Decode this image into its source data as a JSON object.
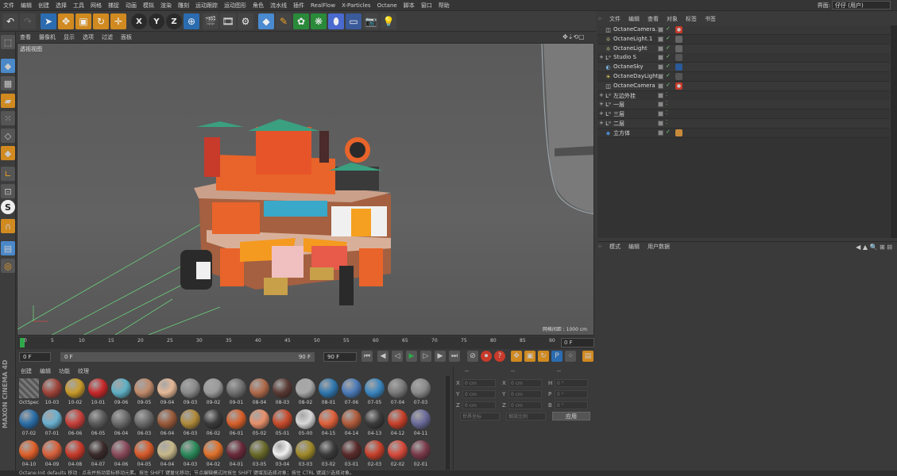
{
  "menubar": {
    "items": [
      "文件",
      "编辑",
      "创建",
      "选择",
      "工具",
      "网格",
      "捕捉",
      "动画",
      "模拟",
      "渲染",
      "雕刻",
      "运动跟踪",
      "运动图形",
      "角色",
      "流水线",
      "插件",
      "RealFlow",
      "X-Particles",
      "Octane",
      "脚本",
      "窗口",
      "帮助"
    ],
    "layout_label": "界面:",
    "layout_value": "仔仔 (用户)"
  },
  "viewport": {
    "menu": [
      "查看",
      "摄像机",
      "显示",
      "选项",
      "过滤",
      "面板"
    ],
    "label": "透视视图",
    "grid_label": "网格间距 : 1000 cm"
  },
  "timeline": {
    "ticks": [
      "0",
      "5",
      "10",
      "15",
      "20",
      "25",
      "30",
      "35",
      "40",
      "45",
      "50",
      "55",
      "60",
      "65",
      "70",
      "75",
      "80",
      "85",
      "90"
    ],
    "current_frame": "0 F",
    "start_field": "0 F",
    "range_start": "0 F",
    "range_end": "90 F",
    "end_field": "90 F"
  },
  "materials": {
    "menu": [
      "创建",
      "编辑",
      "功能",
      "纹理"
    ],
    "items": [
      {
        "label": "OctSpec",
        "color": "#6b6b6b"
      },
      {
        "label": "10-03",
        "color": "#a0443a"
      },
      {
        "label": "10-02",
        "color": "#c89a2a"
      },
      {
        "label": "10-01",
        "color": "#c8282a"
      },
      {
        "label": "09-06",
        "color": "#5fb0c6"
      },
      {
        "label": "09-05",
        "color": "#c08a6a"
      },
      {
        "label": "09-04",
        "color": "#e6b896"
      },
      {
        "label": "09-03",
        "color": "#8a8a8a"
      },
      {
        "label": "09-02",
        "color": "#9a9a9a"
      },
      {
        "label": "09-01",
        "color": "#707070"
      },
      {
        "label": "08-04",
        "color": "#b06a4a"
      },
      {
        "label": "08-03",
        "color": "#5a3a34"
      },
      {
        "label": "08-02",
        "color": "#a8a8a8"
      },
      {
        "label": "08-01",
        "color": "#2f78b0"
      },
      {
        "label": "07-06",
        "color": "#4a7ab8"
      },
      {
        "label": "07-05",
        "color": "#3a86c0"
      },
      {
        "label": "07-04",
        "color": "#7a7a7a"
      },
      {
        "label": "07-03",
        "color": "#8a8a8a"
      },
      {
        "label": "07-02",
        "color": "#2a6ea8"
      },
      {
        "label": "07-01",
        "color": "#6ab0d0"
      },
      {
        "label": "06-06",
        "color": "#c8403a"
      },
      {
        "label": "06-05",
        "color": "#5a5a5a"
      },
      {
        "label": "06-04",
        "color": "#6a6a6a"
      },
      {
        "label": "06-03",
        "color": "#6a6a6a"
      },
      {
        "label": "06-04",
        "color": "#9a5a3a"
      },
      {
        "label": "06-03",
        "color": "#b08a3a"
      },
      {
        "label": "06-02",
        "color": "#3a3a3a"
      },
      {
        "label": "06-01",
        "color": "#d8602a"
      },
      {
        "label": "05-02",
        "color": "#e8906a"
      },
      {
        "label": "05-01",
        "color": "#c84a2a"
      },
      {
        "label": "05-00",
        "color": "#d8d8d8"
      },
      {
        "label": "04-15",
        "color": "#e0603a"
      },
      {
        "label": "04-14",
        "color": "#b05a3a"
      },
      {
        "label": "04-13",
        "color": "#3a3a3a"
      },
      {
        "label": "04-12",
        "color": "#c8402a"
      },
      {
        "label": "04-11",
        "color": "#6a6a9a"
      },
      {
        "label": "04-10",
        "color": "#e0602a"
      },
      {
        "label": "04-09",
        "color": "#d8603a"
      },
      {
        "label": "04-08",
        "color": "#c83a2a"
      },
      {
        "label": "04-07",
        "color": "#3a2a2a"
      },
      {
        "label": "04-06",
        "color": "#8a4a5a"
      },
      {
        "label": "04-05",
        "color": "#d85a2a"
      },
      {
        "label": "04-04",
        "color": "#c8b88a"
      },
      {
        "label": "04-03",
        "color": "#2a8a5a"
      },
      {
        "label": "04-02",
        "color": "#e0702a"
      },
      {
        "label": "04-01",
        "color": "#6a2a3a"
      },
      {
        "label": "03-05",
        "color": "#6a6a2a"
      },
      {
        "label": "03-04",
        "color": "#f0f0f0"
      },
      {
        "label": "03-03",
        "color": "#a08a2a"
      },
      {
        "label": "03-02",
        "color": "#3a3a3a"
      },
      {
        "label": "03-01",
        "color": "#5a2a2a"
      },
      {
        "label": "02-03",
        "color": "#c8402a"
      },
      {
        "label": "02-02",
        "color": "#d84a3a"
      },
      {
        "label": "02-01",
        "color": "#7a3a4a"
      }
    ]
  },
  "coordinates": {
    "header": "--",
    "rows": [
      {
        "a": "X",
        "av": "0 cm",
        "b": "X",
        "bv": "0 cm",
        "c": "H",
        "cv": "0 °"
      },
      {
        "a": "Y",
        "av": "0 cm",
        "b": "Y",
        "bv": "0 cm",
        "c": "P",
        "cv": "0 °"
      },
      {
        "a": "Z",
        "av": "0 cm",
        "b": "Z",
        "bv": "0 cm",
        "c": "B",
        "cv": "0 °"
      }
    ],
    "mode1": "世界坐标",
    "mode2": "缩放比例",
    "apply": "应用"
  },
  "objects": {
    "menu": [
      "文件",
      "编辑",
      "查看",
      "对象",
      "标签",
      "书签"
    ],
    "items": [
      {
        "name": "OctaneCamera.1",
        "icon": "camera-icon"
      },
      {
        "name": "OctaneLight.1",
        "icon": "light-icon"
      },
      {
        "name": "OctaneLight",
        "icon": "light-icon"
      },
      {
        "name": "Studio S",
        "icon": "null-icon"
      },
      {
        "name": "OctaneSky",
        "icon": "sky-icon"
      },
      {
        "name": "OctaneDayLight",
        "icon": "daylight-icon"
      },
      {
        "name": "OctaneCamera",
        "icon": "camera-icon"
      },
      {
        "name": "左边外挂",
        "icon": "null-icon"
      },
      {
        "name": "一层",
        "icon": "null-icon"
      },
      {
        "name": "三层",
        "icon": "null-icon"
      },
      {
        "name": "二层",
        "icon": "null-icon"
      },
      {
        "name": "立方体",
        "icon": "cube-icon"
      }
    ]
  },
  "attributes": {
    "menu": [
      "模式",
      "编辑",
      "用户数据"
    ]
  },
  "status": {
    "text": "Octane:Init defaults    移动 : 点击并拖动鼠标移动元素。按住 SHIFT 键量化移动；节点编辑模式时按住 SHIFT 键增加选择对象；按住 CTRL 键减少选择对象。",
    "logo": "MAXON CINEMA 4D"
  },
  "colors": {
    "accent": "#f5a623",
    "panel": "#3a3a3a",
    "selection": "#4a6ea8"
  }
}
